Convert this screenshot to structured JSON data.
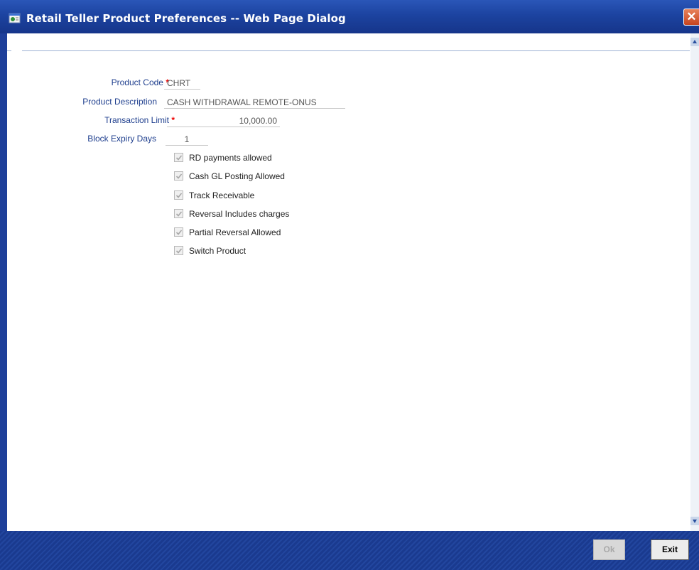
{
  "window": {
    "title": "Retail Teller Product Preferences -- Web Page Dialog",
    "close_glyph": "✕",
    "close_icon": "close-icon",
    "title_icon": "web-dialog-icon"
  },
  "form": {
    "product_code": {
      "label": "Product Code",
      "required_mark": "*",
      "value": "CHRT"
    },
    "product_description": {
      "label": "Product Description",
      "value": "CASH WITHDRAWAL REMOTE-ONUS"
    },
    "transaction_limit": {
      "label": "Transaction Limit",
      "required_mark": "*",
      "value": "10,000.00"
    },
    "block_expiry_days": {
      "label": "Block Expiry Days",
      "value": "1"
    }
  },
  "checkboxes": [
    {
      "label": "RD payments allowed",
      "checked": true
    },
    {
      "label": "Cash GL Posting Allowed",
      "checked": true
    },
    {
      "label": "Track Receivable",
      "checked": true
    },
    {
      "label": "Reversal Includes charges",
      "checked": true
    },
    {
      "label": "Partial Reversal Allowed",
      "checked": true
    },
    {
      "label": "Switch Product",
      "checked": true
    }
  ],
  "buttons": {
    "ok": "Ok",
    "exit": "Exit"
  },
  "colors": {
    "titlebar": "#1c43a0",
    "label": "#1f3f8e",
    "required": "#e00000",
    "footer": "#1a3a8f"
  }
}
